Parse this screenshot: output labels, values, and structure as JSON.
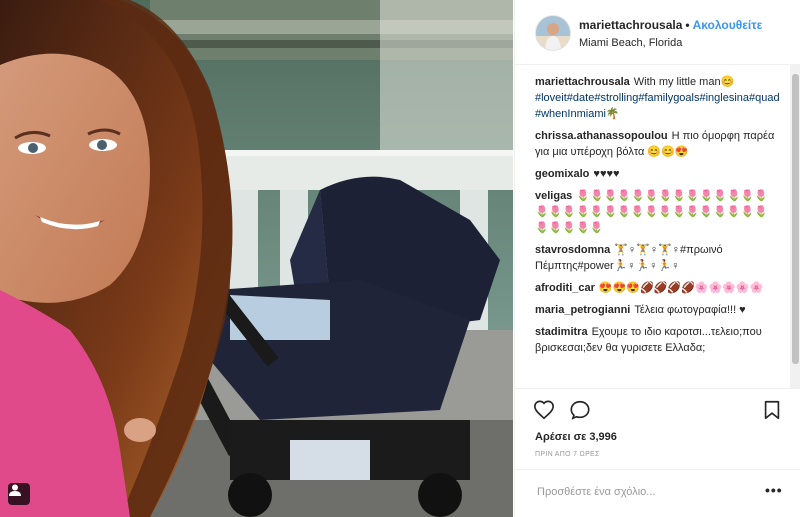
{
  "post": {
    "header": {
      "username": "mariettachrousala",
      "separator": "•",
      "follow_label": "Ακολουθείτε",
      "location": "Miami Beach, Florida"
    },
    "caption": {
      "username": "mariettachrousala",
      "text": "With my little man",
      "emoji": "😊",
      "hashtags": "#loveit#date#strolling#familygoals#inglesina#quad#whenInmiami",
      "hashtags_end_emoji": "🌴"
    },
    "comments": [
      {
        "username": "chrissa.athanassopoulou",
        "text": "Η πιο όμορφη παρέα για μια υπέροχη βόλτα 😊😊😍"
      },
      {
        "username": "geomixalo",
        "text": "♥♥♥♥"
      },
      {
        "username": "veligas",
        "text": "🌷🌷🌷🌷🌷🌷🌷🌷🌷🌷🌷🌷🌷🌷🌷🌷🌷🌷🌷🌷🌷🌷🌷🌷🌷🌷🌷🌷🌷🌷🌷🌷🌷🌷🌷🌷"
      },
      {
        "username": "stavrosdomna",
        "text": "🏋♀🏋♀🏋♀#πρωινό Πέμπτης#power🏃♀🏃♀🏃♀"
      },
      {
        "username": "afroditi_car",
        "text": "😍😍😍🏈🏈🏈🏈🌸🌸🌸🌸🌸"
      },
      {
        "username": "maria_petrogianni",
        "text": "Τέλεια φωτογραφία!!! ♥"
      },
      {
        "username": "stadimitra",
        "text": "Εχουμε το ιδιο καροτσι...τελειο;που βρισκεσαι;δεν θα γυρισετε Ελλαδα;"
      }
    ],
    "likes_text": "Αρέσει σε 3,996",
    "time_text": "ΠΡΙΝ ΑΠΟ 7 ΩΡΕΣ",
    "add_comment_placeholder": "Προσθέστε ένα σχόλιο...",
    "more_label": "•••",
    "icons": {
      "like": "heart-outline",
      "comment": "speech-bubble",
      "save": "bookmark-outline",
      "tagged": "person-tag"
    },
    "colors": {
      "follow": "#3897f0",
      "hashtag": "#003569",
      "text": "#262626",
      "muted": "#999999"
    }
  }
}
